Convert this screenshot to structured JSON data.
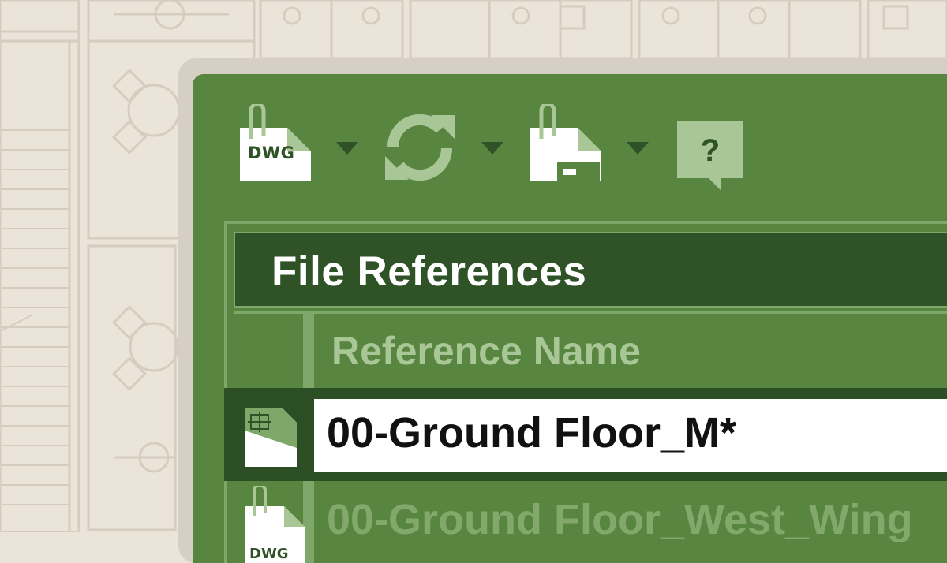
{
  "toolbar": {
    "items": [
      {
        "icon": "attach-dwg-icon",
        "label": "DWG",
        "has_dropdown": true
      },
      {
        "icon": "refresh-icon",
        "has_dropdown": true
      },
      {
        "icon": "attach-image-icon",
        "has_dropdown": true
      },
      {
        "icon": "help-icon",
        "label": "?"
      }
    ]
  },
  "references": {
    "title": "File References",
    "column_header": "Reference Name",
    "rows": [
      {
        "name": "00-Ground Floor_M*",
        "selected": true,
        "icon": "drawing-file-icon"
      },
      {
        "name": "00-Ground Floor_West_Wing",
        "selected": false,
        "icon": "dwg-file-icon",
        "type_label": "DWG"
      }
    ]
  },
  "colors": {
    "panel": "#588540",
    "panel_dark": "#2f5227",
    "grid_line": "#80a76a",
    "background": "#ebe4d9"
  }
}
